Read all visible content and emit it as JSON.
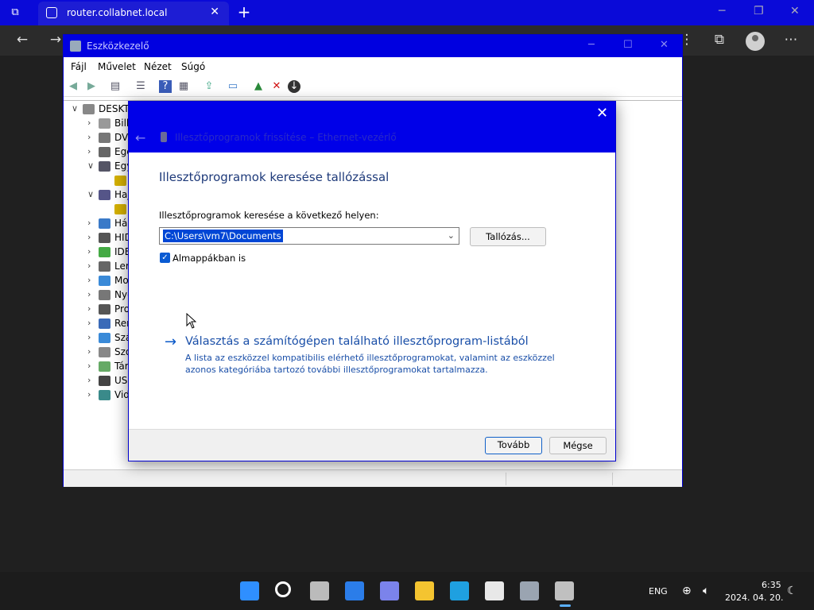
{
  "browser": {
    "tab_title": "router.collabnet.local",
    "close_tab": "✕",
    "new_tab": "+"
  },
  "devmgr": {
    "title": "Eszközkezelő",
    "menu": [
      "Fájl",
      "Művelet",
      "Nézet",
      "Súgó"
    ],
    "tree": [
      {
        "label": "DESKTOP",
        "level": 0,
        "expander": "∨",
        "color": "#888"
      },
      {
        "label": "Bill",
        "level": 1,
        "expander": "›",
        "color": "#999"
      },
      {
        "label": "DVD",
        "level": 1,
        "expander": "›",
        "color": "#777"
      },
      {
        "label": "Egé",
        "level": 1,
        "expander": "›",
        "color": "#666"
      },
      {
        "label": "Egy",
        "level": 1,
        "expander": "∨",
        "color": "#556"
      },
      {
        "label": "",
        "level": 2,
        "expander": "",
        "color": "#d4b000"
      },
      {
        "label": "Hajt",
        "level": 1,
        "expander": "∨",
        "color": "#558"
      },
      {
        "label": "",
        "level": 2,
        "expander": "",
        "color": "#d4b000"
      },
      {
        "label": "Hál",
        "level": 1,
        "expander": "›",
        "color": "#3a7ac8"
      },
      {
        "label": "HID",
        "level": 1,
        "expander": "›",
        "color": "#555"
      },
      {
        "label": "IDE",
        "level": 1,
        "expander": "›",
        "color": "#4a4"
      },
      {
        "label": "Lem",
        "level": 1,
        "expander": "›",
        "color": "#666"
      },
      {
        "label": "Mo",
        "level": 1,
        "expander": "›",
        "color": "#3a8ad8"
      },
      {
        "label": "Nyo",
        "level": 1,
        "expander": "›",
        "color": "#777"
      },
      {
        "label": "Pro",
        "level": 1,
        "expander": "›",
        "color": "#555"
      },
      {
        "label": "Ren",
        "level": 1,
        "expander": "›",
        "color": "#3a6ab8"
      },
      {
        "label": "Szá",
        "level": 1,
        "expander": "›",
        "color": "#3a8ad8"
      },
      {
        "label": "Szo",
        "level": 1,
        "expander": "›",
        "color": "#888"
      },
      {
        "label": "Tár",
        "level": 1,
        "expander": "›",
        "color": "#6a6"
      },
      {
        "label": "USB",
        "level": 1,
        "expander": "›",
        "color": "#444"
      },
      {
        "label": "Vid",
        "level": 1,
        "expander": "›",
        "color": "#3a8a8a"
      }
    ]
  },
  "wizard": {
    "close": "✕",
    "header_text": "Illesztőprogramok frissítése – Ethernet-vezérlő",
    "heading": "Illesztőprogramok keresése tallózással",
    "search_label": "Illesztőprogramok keresése a következő helyen:",
    "path_value": "C:\\Users\\vm7\\Documents",
    "browse_label": "Tallózás...",
    "subfolders_label": "Almappákban is",
    "subfolders_checked": true,
    "pick_title": "Választás a számítógépen található illesztőprogram-listából",
    "pick_desc": "A lista az eszközzel kompatibilis elérhető illesztőprogramokat, valamint az eszközzel azonos kategóriába tartozó további illesztőprogramokat tartalmazza.",
    "next_label": "Tovább",
    "cancel_label": "Mégse"
  },
  "taskbar": {
    "lang": "ENG",
    "time": "6:35",
    "date": "2024. 04. 20.",
    "apps": [
      {
        "name": "start-icon",
        "color": "#2f8fff"
      },
      {
        "name": "search-icon",
        "color": "#ffffff"
      },
      {
        "name": "task-view-icon",
        "color": "#bbbbbb"
      },
      {
        "name": "widgets-icon",
        "color": "#2b7de9"
      },
      {
        "name": "teams-chat-icon",
        "color": "#7b83eb"
      },
      {
        "name": "file-explorer-icon",
        "color": "#f4c430"
      },
      {
        "name": "edge-icon",
        "color": "#1fa0e0"
      },
      {
        "name": "store-icon",
        "color": "#e8e8e8"
      },
      {
        "name": "settings-icon",
        "color": "#9aa4b1"
      },
      {
        "name": "device-manager-icon",
        "color": "#c0c0c0"
      }
    ]
  }
}
